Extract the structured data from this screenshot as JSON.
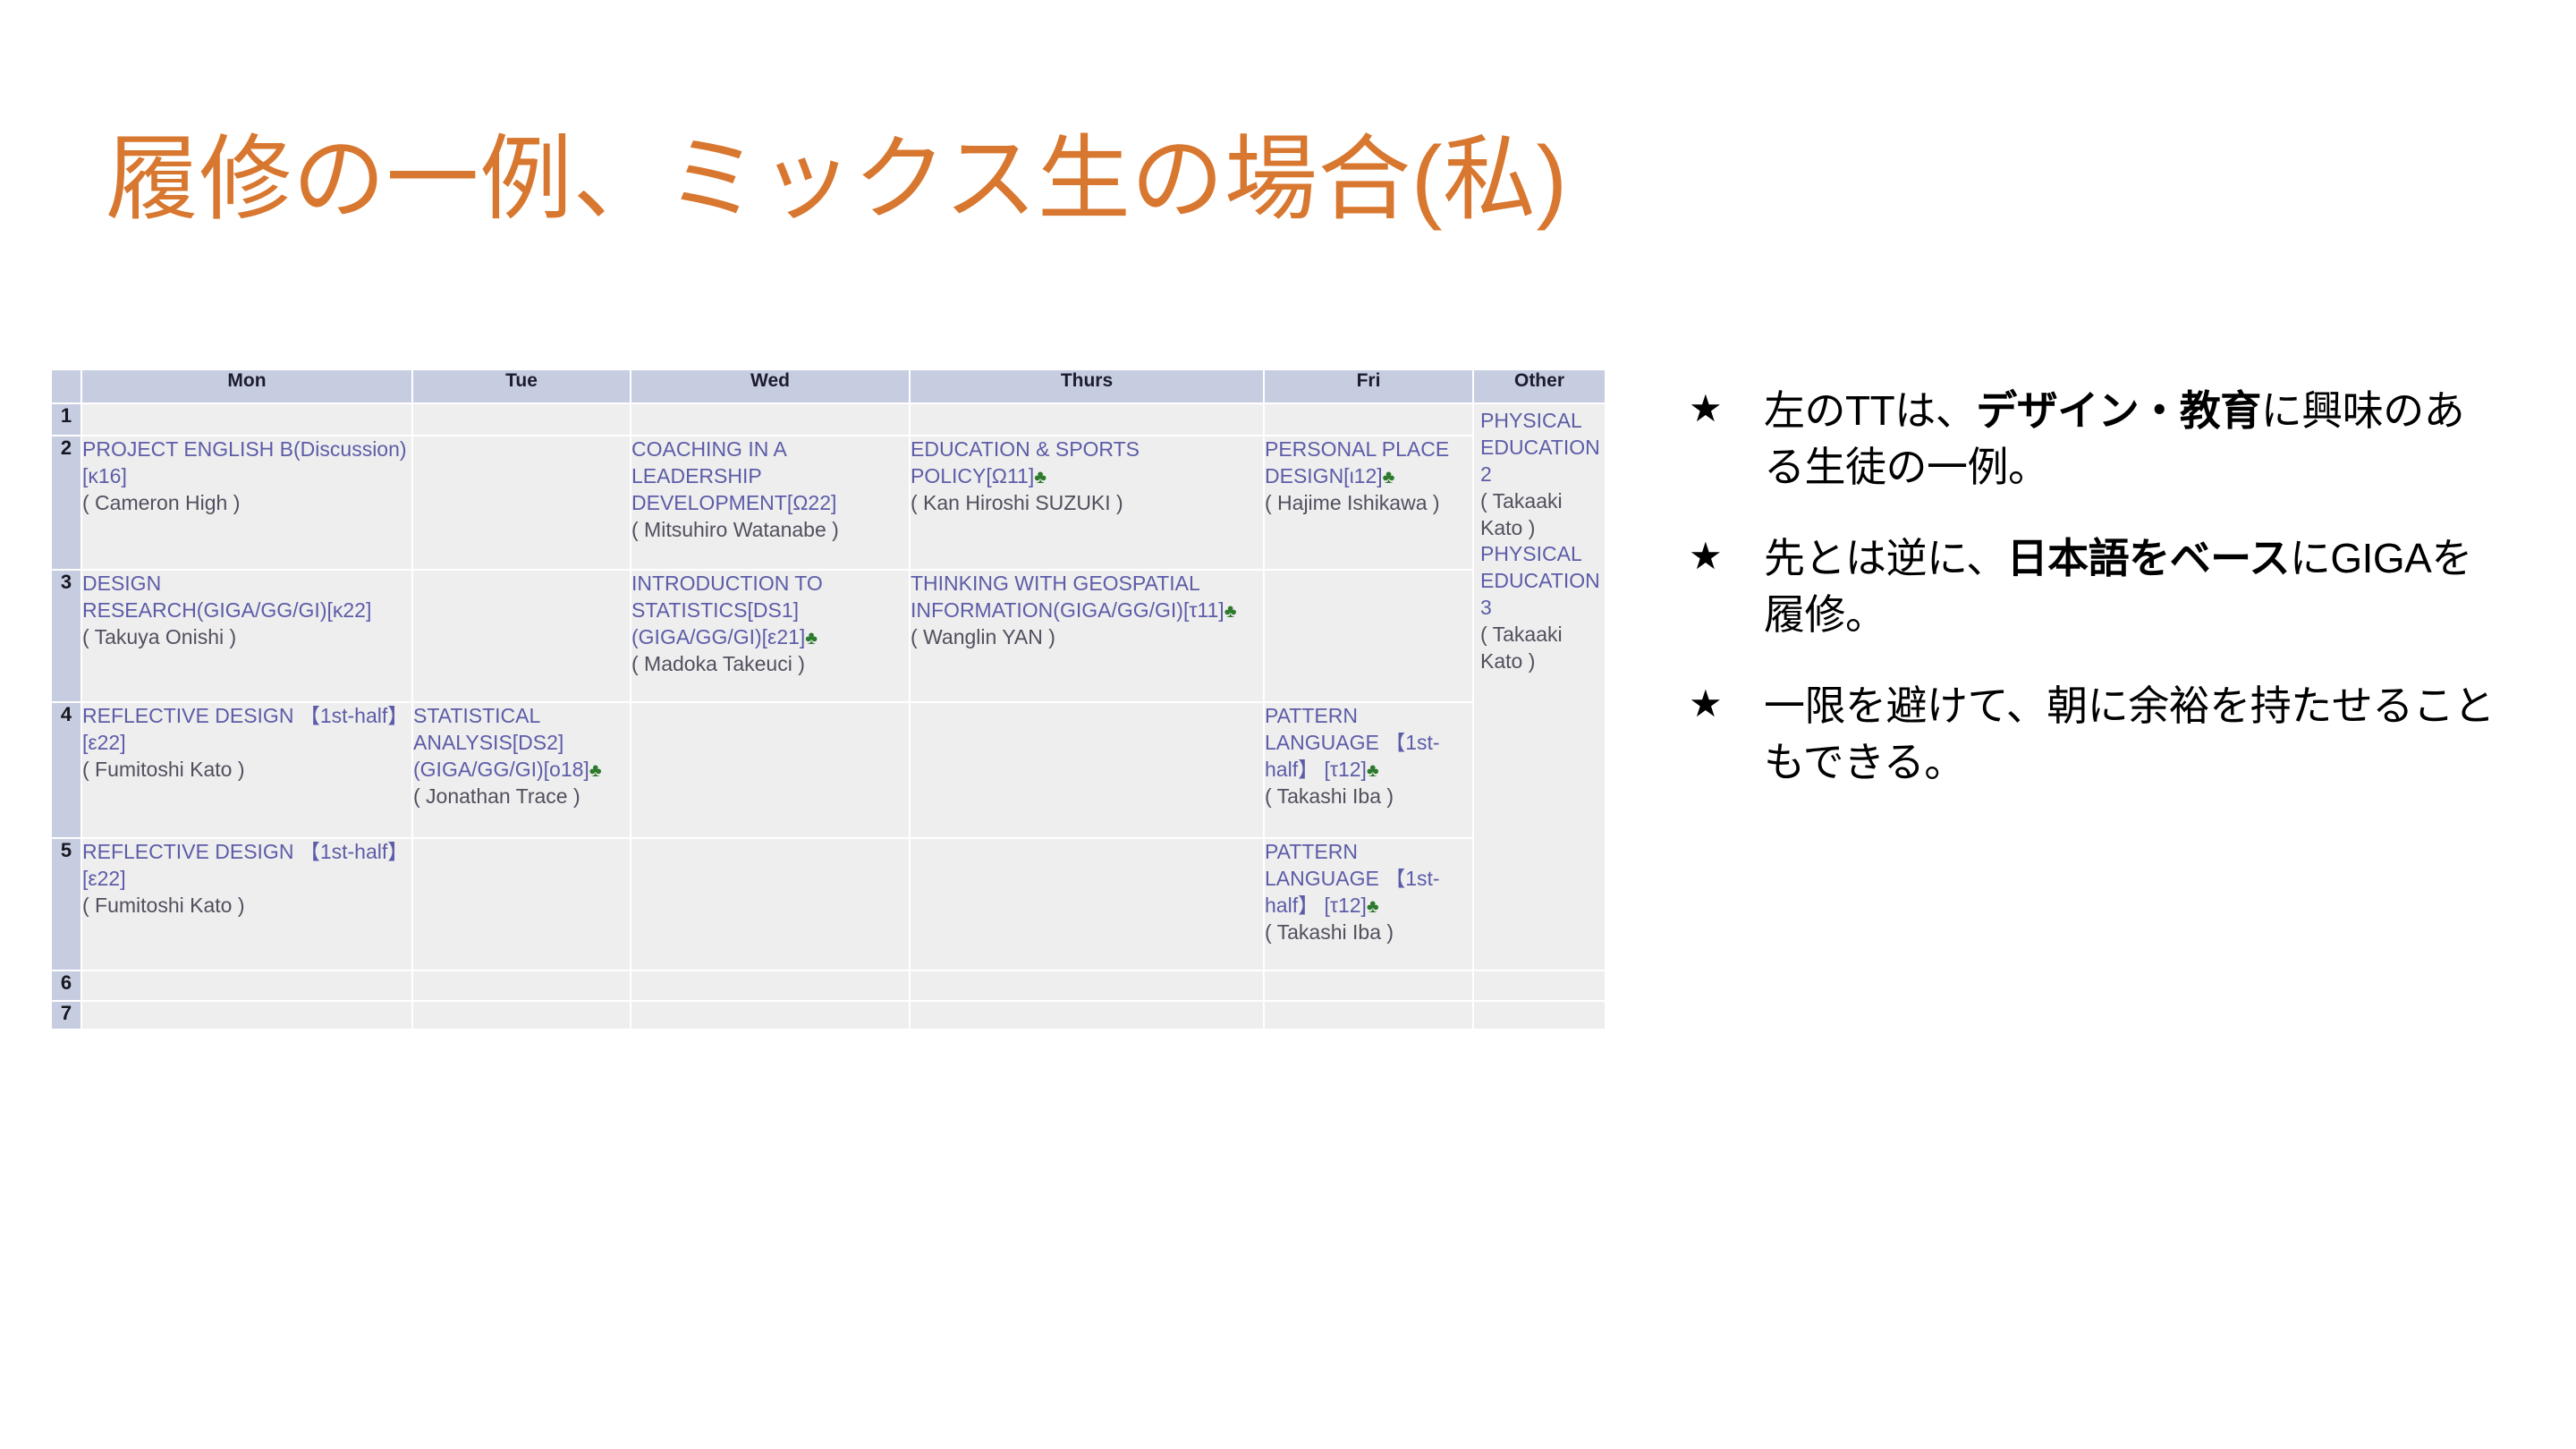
{
  "slide": {
    "title": "履修の一例、ミックス生の場合(私)",
    "title_color": "#d8772f"
  },
  "timetable": {
    "corner_label": "",
    "columns": [
      "Mon",
      "Tue",
      "Wed",
      "Thurs",
      "Fri",
      "Other"
    ],
    "row_numbers": [
      "1",
      "2",
      "3",
      "4",
      "5",
      "6",
      "7"
    ],
    "club_symbol": "♣",
    "other_column": {
      "course_1": "PHYSICAL EDUCATION 2",
      "teacher_1": "( Takaaki Kato )",
      "course_2": "PHYSICAL EDUCATION 3",
      "teacher_2": "( Takaaki Kato )"
    },
    "rows": [
      {
        "num": "1",
        "mon_course": "",
        "mon_teacher": "",
        "tue_course": "",
        "tue_teacher": "",
        "wed_course": "",
        "wed_teacher": "",
        "thu_course": "",
        "thu_teacher": "",
        "fri_course": "",
        "fri_teacher": ""
      },
      {
        "num": "2",
        "mon_course": "PROJECT ENGLISH B(Discussion)[κ16]",
        "mon_teacher": "( Cameron High )",
        "tue_course": "",
        "tue_teacher": "",
        "wed_course": "COACHING IN A LEADERSHIP DEVELOPMENT[Ω22]",
        "wed_teacher": "( Mitsuhiro Watanabe )",
        "thu_course": "EDUCATION & SPORTS POLICY[Ω11]",
        "thu_club": "♣",
        "thu_teacher": "( Kan Hiroshi SUZUKI )",
        "fri_course": "PERSONAL PLACE DESIGN[ι12]",
        "fri_club": "♣",
        "fri_teacher": "( Hajime Ishikawa )"
      },
      {
        "num": "3",
        "mon_course": "DESIGN RESEARCH(GIGA/GG/GI)[κ22]",
        "mon_teacher": "( Takuya Onishi )",
        "tue_course": "",
        "tue_teacher": "",
        "wed_course": "INTRODUCTION TO STATISTICS[DS1](GIGA/GG/GI)[ε21]",
        "wed_club": "♣",
        "wed_teacher": "( Madoka Takeuci )",
        "thu_course": "THINKING WITH GEOSPATIAL INFORMATION(GIGA/GG/GI)[τ11]",
        "thu_club": "♣",
        "thu_teacher": "( Wanglin YAN )",
        "fri_course": "",
        "fri_teacher": ""
      },
      {
        "num": "4",
        "mon_course": "REFLECTIVE DESIGN 【1st-half】 [ε22]",
        "mon_teacher": "( Fumitoshi Kato )",
        "tue_course": "STATISTICAL ANALYSIS[DS2](GIGA/GG/GI)[o18]",
        "tue_club": "♣",
        "tue_teacher": "( Jonathan Trace )",
        "wed_course": "",
        "wed_teacher": "",
        "thu_course": "",
        "thu_teacher": "",
        "fri_course": "PATTERN LANGUAGE 【1st-half】 [τ12]",
        "fri_club": "♣",
        "fri_teacher": "( Takashi Iba )"
      },
      {
        "num": "5",
        "mon_course": "REFLECTIVE DESIGN 【1st-half】 [ε22]",
        "mon_teacher": "( Fumitoshi Kato )",
        "tue_course": "",
        "tue_teacher": "",
        "wed_course": "",
        "wed_teacher": "",
        "thu_course": "",
        "thu_teacher": "",
        "fri_course": "PATTERN LANGUAGE 【1st-half】 [τ12]",
        "fri_club": "♣",
        "fri_teacher": "( Takashi Iba )"
      },
      {
        "num": "6",
        "mon_course": "",
        "mon_teacher": "",
        "tue_course": "",
        "tue_teacher": "",
        "wed_course": "",
        "wed_teacher": "",
        "thu_course": "",
        "thu_teacher": "",
        "fri_course": "",
        "fri_teacher": ""
      },
      {
        "num": "7",
        "mon_course": "",
        "mon_teacher": "",
        "tue_course": "",
        "tue_teacher": "",
        "wed_course": "",
        "wed_teacher": "",
        "thu_course": "",
        "thu_teacher": "",
        "fri_course": "",
        "fri_teacher": ""
      }
    ]
  },
  "bullets": [
    {
      "marker": "★",
      "pre": "左のTTは、",
      "bold": "デザイン・教育",
      "post": "に興味のある生徒の一例。"
    },
    {
      "marker": "★",
      "pre": "先とは逆に、",
      "bold": "日本語をベース",
      "post": "にGIGAを履修。"
    },
    {
      "marker": "★",
      "pre": "一限を避けて、朝に余裕を持たせることもできる。",
      "bold": "",
      "post": ""
    }
  ]
}
